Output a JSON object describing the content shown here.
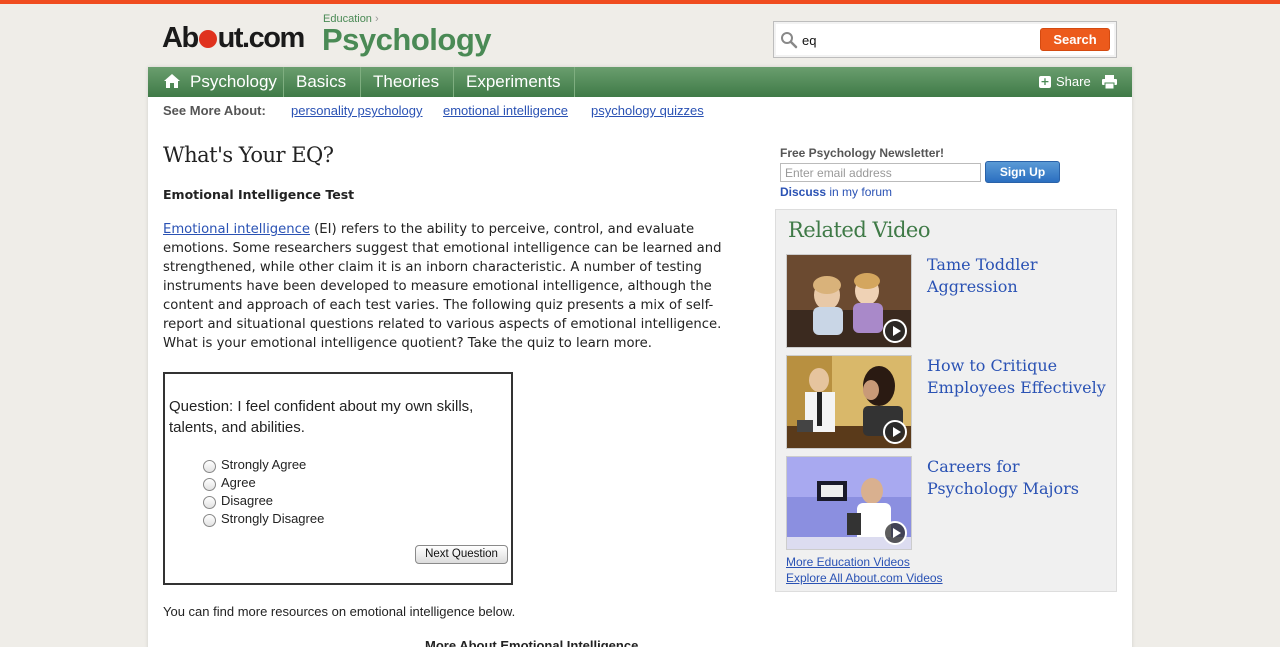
{
  "header": {
    "logo": {
      "before_dot": "Ab",
      "after_dot": "ut.com"
    },
    "breadcrumb": "Education",
    "site_title": "Psychology",
    "search": {
      "value": "eq",
      "button_label": "Search"
    }
  },
  "nav": {
    "items": [
      {
        "label": "Psychology"
      },
      {
        "label": "Basics"
      },
      {
        "label": "Theories"
      },
      {
        "label": "Experiments"
      }
    ],
    "share_label": "Share"
  },
  "see_more": {
    "label": "See More About:",
    "links": [
      "personality psychology",
      "emotional intelligence",
      "psychology quizzes"
    ]
  },
  "article": {
    "title": "What's Your EQ?",
    "subhead": "Emotional Intelligence Test",
    "intro_link": "Emotional intelligence",
    "intro_text": " (EI) refers to the ability to perceive, control, and evaluate emotions. Some researchers suggest that emotional intelligence can be learned and strengthened, while other claim it is an inborn characteristic. A number of testing instruments have been developed to measure emotional intelligence, although the content and approach of each test varies. The following quiz presents a mix of self-report and situational questions related to various aspects of emotional intelligence. What is your emotional intelligence quotient? Take the quiz to learn more.",
    "resources_text": "You can find more resources on emotional intelligence below.",
    "more_about_heading": "More About Emotional Intelligence"
  },
  "quiz": {
    "question": "Question: I feel confident about my own skills, talents, and abilities.",
    "options": [
      "Strongly Agree",
      "Agree",
      "Disagree",
      "Strongly Disagree"
    ],
    "next_label": "Next Question"
  },
  "sidebar": {
    "newsletter_title": "Free Psychology Newsletter!",
    "email_placeholder": "Enter email address",
    "signup_label": "Sign Up",
    "discuss_bold": "Discuss",
    "discuss_rest": " in my forum",
    "related_title": "Related Video",
    "videos": [
      {
        "title": "Tame Toddler Aggression"
      },
      {
        "title": "How to Critique Employees Effectively"
      },
      {
        "title": "Careers for Psychology Majors"
      }
    ],
    "more_videos_label": "More Education Videos",
    "explore_label": "Explore All About.com Videos"
  },
  "colors": {
    "accent_orange": "#ec5a1c",
    "brand_green": "#4a8a55",
    "link_blue": "#2a52b4"
  }
}
